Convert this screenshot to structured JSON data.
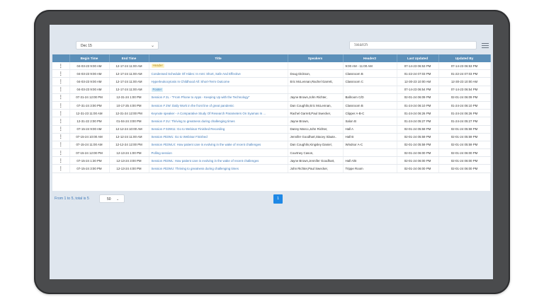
{
  "filter": {
    "selected": "Dec 15"
  },
  "search": {
    "placeholder": "Search"
  },
  "table": {
    "headers": [
      "",
      "Begin Time",
      "End Time",
      "Title",
      "Speakers",
      "Header2",
      "Last Updated",
      "Updated By"
    ],
    "rows": [
      {
        "begin": "04-03-23 9:00 AM",
        "end": "12-17-24 11:00 AM",
        "title": "Header",
        "tag": "header",
        "speakers": "",
        "header2": "9:00 AM - 11:00 AM",
        "updated": "07-14-23 06:53 PM",
        "by": "07-14-23 06:53 PM"
      },
      {
        "begin": "04-03-23 9:00 AM",
        "end": "12-17-24 11:00 AM",
        "title": "Condensed Schedule Of Hides: In Amt: Short, Safe And Effective",
        "tag": "",
        "speakers": "Doug Dickson,",
        "header2": "Classroom B",
        "updated": "01-22-24 07:03 PM",
        "by": "01-22-24 07:03 PM"
      },
      {
        "begin": "04-03-23 9:00 AM",
        "end": "12-17-24 11:00 AM",
        "title": "Hyperleukocytosis In Childhood All: Short-Term Outcome",
        "tag": "",
        "speakers": "Eric McLennan,Rachel Garrett,",
        "header2": "Classroom C",
        "updated": "12-30-23 10:00 AM",
        "by": "12-30-23 10:00 AM"
      },
      {
        "begin": "04-03-23 9:00 AM",
        "end": "12-17-24 11:00 AM",
        "title": "Footer",
        "tag": "footer",
        "speakers": "",
        "header2": "",
        "updated": "07-14-23 06:54 PM",
        "by": "07-14-23 06:54 PM"
      },
      {
        "begin": "07-31-24 12:00 PM",
        "end": "12-31-24 1:00 PM",
        "title": "Session # 2L - \"From Phone to Apps - Keeping Up with the Technology\"",
        "tag": "",
        "speakers": "Jayne Brown,John Richter,",
        "header2": "Ballroom C/D",
        "updated": "02-01-24 06:09 PM",
        "by": "02-01-24 06:09 PM"
      },
      {
        "begin": "07-31-24 3:00 PM",
        "end": "10-17-25 4:00 PM",
        "title": "Session # 2W: Daily Work in the front line of great pandemic",
        "tag": "",
        "speakers": "Dan Coughlin,Eric McLennan,",
        "header2": "Classroom B",
        "updated": "01-24-24 06:10 PM",
        "by": "01-24-24 06:10 PM"
      },
      {
        "begin": "12-31-23 11:00 AM",
        "end": "12-31-24 12:00 PM",
        "title": "Keynote speaker - A Comparative Study Of Research Parameters On Syamas In ...",
        "tag": "",
        "speakers": "Rachel Garrett,Paul Swecker,",
        "header2": "Clipper A-B-C",
        "updated": "01-24-24 06:26 PM",
        "by": "01-24-24 06:26 PM"
      },
      {
        "begin": "12-31-22 2:00 PM",
        "end": "01-04-24 3:00 PM",
        "title": "Session # 2U: Thriving to greatness during challenging times",
        "tag": "",
        "speakers": "Jayne Brown,",
        "header2": "Salon B",
        "updated": "01-24-24 05:27 PM",
        "by": "01-24-24 05:27 PM"
      },
      {
        "begin": "07-15-24 9:00 AM",
        "end": "12-12-24 10:00 AM",
        "title": "Session # 02W11: Go to Webinar Finished Recording",
        "tag": "",
        "speakers": "Danny Marco,John Richter,",
        "header2": "Hall A",
        "updated": "02-01-24 05:59 PM",
        "by": "02-01-24 05:59 PM"
      },
      {
        "begin": "07-15-24 10:00 AM",
        "end": "12-12-24 11:00 AM",
        "title": "Session #02W1: Go to Webinar Finished",
        "tag": "",
        "speakers": "Jennifer Goodhart,Stacey Slaute..",
        "header2": "Hall B",
        "updated": "02-01-24 05:59 PM",
        "by": "02-01-24 05:59 PM"
      },
      {
        "begin": "07-15-24 11:00 AM",
        "end": "12-12-24 12:00 PM",
        "title": "Session #02WLX: How patient care is evolving in the wake of recent challenges",
        "tag": "",
        "speakers": "Dan Coughlin,Kingsley Daniel,",
        "header2": "Windsor A-C",
        "updated": "02-01-24 05:59 PM",
        "by": "02-01-24 05:59 PM"
      },
      {
        "begin": "07-15-24 12:00 PM",
        "end": "12-13-24 1:00 PM",
        "title": "Polling session",
        "tag": "",
        "speakers": "Courtney Cason,",
        "header2": "",
        "updated": "02-01-24 06:00 PM",
        "by": "02-01-24 06:00 PM"
      },
      {
        "begin": "07-15-24 1:30 PM",
        "end": "12-13-24 3:00 PM",
        "title": "Session #02WL: How patient care is evolving in the wake of recent challenges",
        "tag": "",
        "speakers": "Jayne Brown,Jennifer Goodhart,",
        "header2": "Hall A/B",
        "updated": "02-01-24 06:00 PM",
        "by": "02-01-24 06:00 PM"
      },
      {
        "begin": "07-15-24 3:00 PM",
        "end": "12-13-24 4:00 PM",
        "title": "Session #02WU: Thriving to greatness during challenging times",
        "tag": "",
        "speakers": "John Richter,Paul Swecker,",
        "header2": "Trippe Room",
        "updated": "02-01-24 06:00 PM",
        "by": "02-01-24 06:00 PM"
      }
    ]
  },
  "pagination": {
    "summary": "From 1 to 5, total is 5",
    "page_size": "50",
    "current_page": "1"
  }
}
